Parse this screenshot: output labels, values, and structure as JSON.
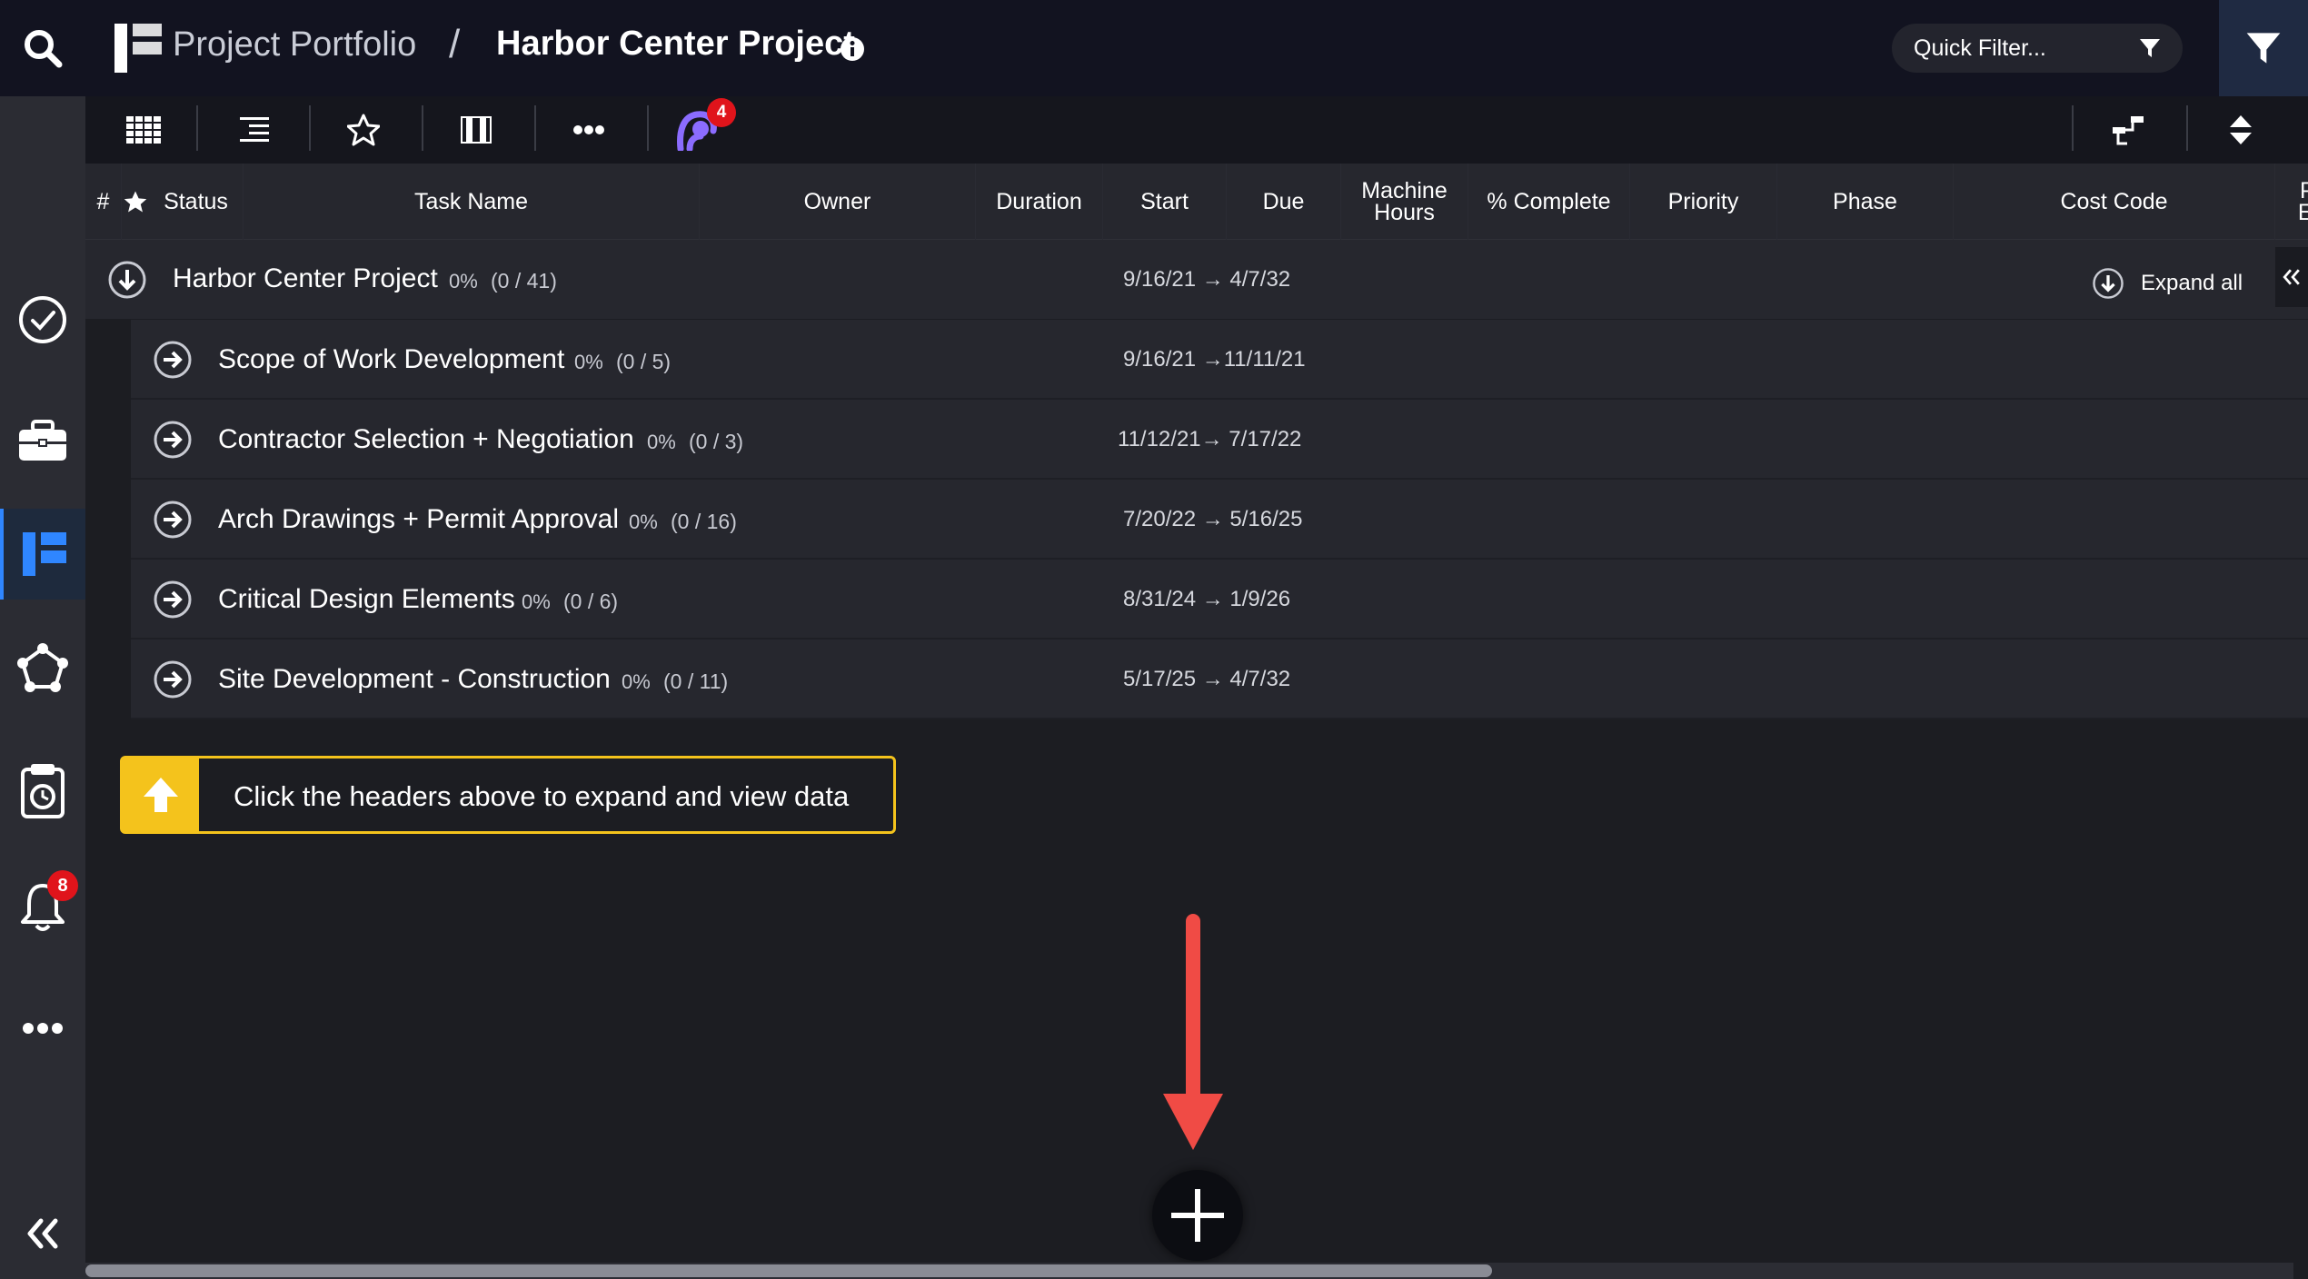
{
  "header": {
    "portfolio_label": "Project Portfolio",
    "separator": "/",
    "project_title": "Harbor Center Project",
    "quick_filter_placeholder": "Quick Filter..."
  },
  "rail": {
    "notification_count": "8"
  },
  "toolbar": {
    "avatar_badge_count": "4"
  },
  "table": {
    "columns": [
      "#",
      "Status",
      "Task Name",
      "Owner",
      "Duration",
      "Start",
      "Due",
      "Machine Hours",
      "% Complete",
      "Priority",
      "Phase",
      "Cost Code",
      "Pr Es"
    ],
    "top_row": {
      "name": "Harbor Center Project",
      "pct": "0%",
      "count": "(0 / 41)",
      "dates": "9/16/21 → 4/7/32"
    },
    "expand_all_label": "Expand all",
    "rows": [
      {
        "name": "Scope of Work Development",
        "pct": "0%",
        "count": "(0 / 5)",
        "dates": "9/16/21 →11/11/21"
      },
      {
        "name": "Contractor Selection + Negotiation",
        "pct": "0%",
        "count": "(0 / 3)",
        "dates": "11/12/21→ 7/17/22"
      },
      {
        "name": "Arch Drawings + Permit Approval",
        "pct": "0%",
        "count": "(0 / 16)",
        "dates": "7/20/22 → 5/16/25"
      },
      {
        "name": "Critical Design Elements",
        "pct": "0%",
        "count": "(0 / 6)",
        "dates": "8/31/24 → 1/9/26"
      },
      {
        "name": "Site Development - Construction",
        "pct": "0%",
        "count": "(0 / 11)",
        "dates": "5/17/25 → 4/7/32"
      }
    ]
  },
  "hint": {
    "text": "Click the headers above to expand and view data"
  },
  "colors": {
    "accent": "#2f86ff",
    "hint_yellow": "#f4c31c",
    "annotation_arrow": "#f04b45",
    "badge_red": "#e0141b"
  }
}
